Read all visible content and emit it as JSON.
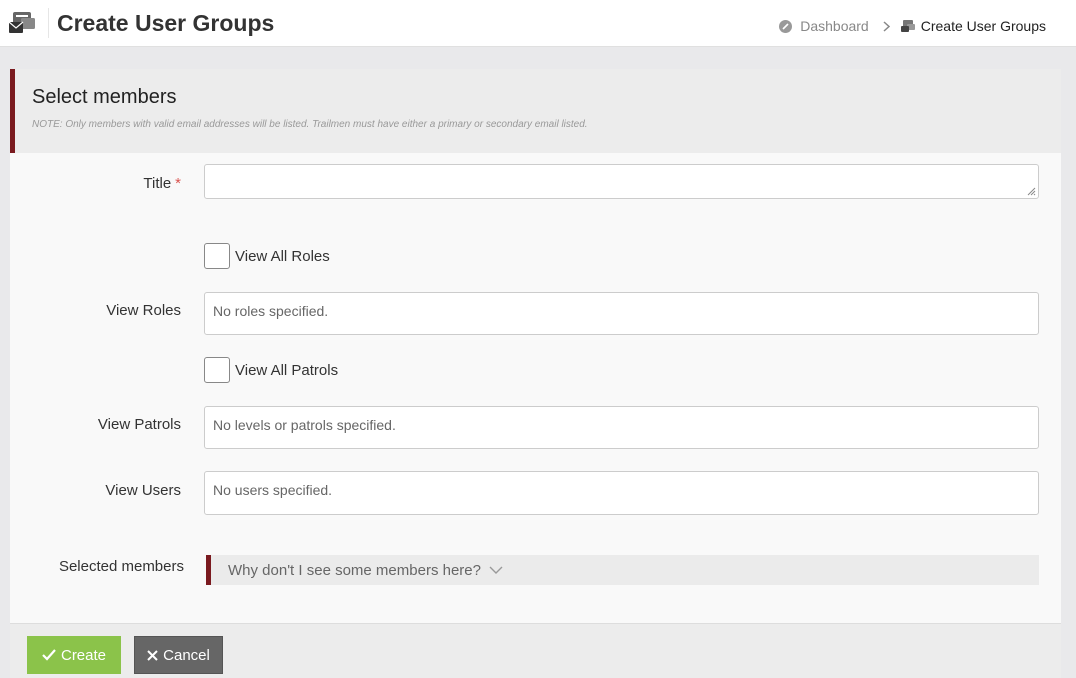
{
  "header": {
    "title": "Create User Groups",
    "breadcrumb": {
      "dashboard": "Dashboard",
      "current": "Create User Groups"
    }
  },
  "panel": {
    "heading": "Select members",
    "note": "NOTE: Only members with valid email addresses will be listed. Trailmen must have either a primary or secondary email listed."
  },
  "form": {
    "title_label": "Title",
    "title_value": "",
    "required_mark": "*",
    "view_all_roles_label": "View All Roles",
    "view_roles_label": "View Roles",
    "view_roles_placeholder": "No roles specified.",
    "view_all_patrols_label": "View All Patrols",
    "view_patrols_label": "View Patrols",
    "view_patrols_placeholder": "No levels or patrols specified.",
    "view_users_label": "View Users",
    "view_users_placeholder": "No users specified.",
    "selected_members_label": "Selected members",
    "accordion_label": "Why don't I see some members here?"
  },
  "actions": {
    "create_label": "Create",
    "cancel_label": "Cancel"
  },
  "colors": {
    "accent": "#7a1a1f",
    "create_button": "#8bc34a",
    "cancel_button": "#666666",
    "required": "#d9534f"
  },
  "icons": [
    "user-groups-icon",
    "dashboard-icon",
    "chevron-right-icon",
    "check-icon",
    "close-icon",
    "chevron-down-icon"
  ]
}
